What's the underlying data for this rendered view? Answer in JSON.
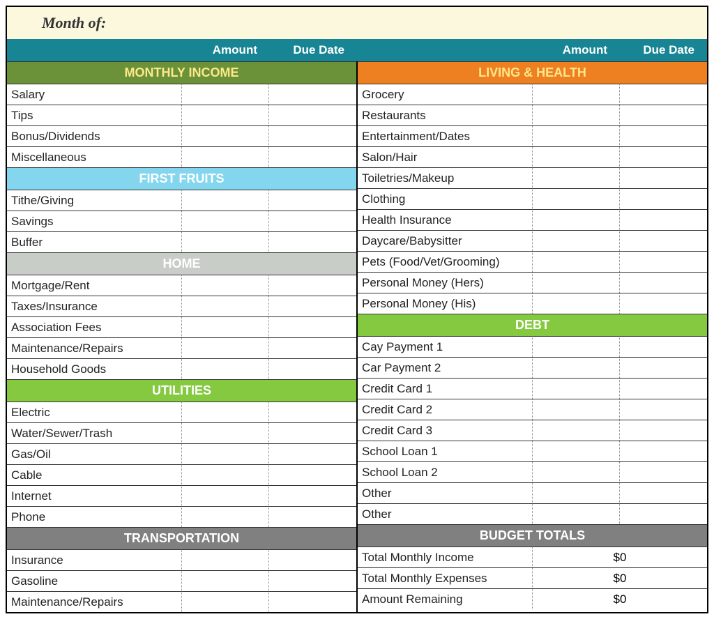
{
  "header": {
    "title": "Month of:"
  },
  "columns": {
    "amount": "Amount",
    "due_date": "Due Date"
  },
  "left": {
    "sections": [
      {
        "title": "MONTHLY INCOME",
        "class": "hdr-income",
        "items": [
          {
            "label": "Salary",
            "amount": "",
            "due": ""
          },
          {
            "label": "Tips",
            "amount": "",
            "due": ""
          },
          {
            "label": "Bonus/Dividends",
            "amount": "",
            "due": ""
          },
          {
            "label": "Miscellaneous",
            "amount": "",
            "due": ""
          }
        ]
      },
      {
        "title": "FIRST FRUITS",
        "class": "hdr-firstfruits",
        "items": [
          {
            "label": "Tithe/Giving",
            "amount": "",
            "due": ""
          },
          {
            "label": "Savings",
            "amount": "",
            "due": ""
          },
          {
            "label": "Buffer",
            "amount": "",
            "due": ""
          }
        ]
      },
      {
        "title": "HOME",
        "class": "hdr-home",
        "items": [
          {
            "label": "Mortgage/Rent",
            "amount": "",
            "due": ""
          },
          {
            "label": "Taxes/Insurance",
            "amount": "",
            "due": ""
          },
          {
            "label": "Association Fees",
            "amount": "",
            "due": ""
          },
          {
            "label": "Maintenance/Repairs",
            "amount": "",
            "due": ""
          },
          {
            "label": "Household Goods",
            "amount": "",
            "due": ""
          }
        ]
      },
      {
        "title": "UTILITIES",
        "class": "hdr-utilities",
        "items": [
          {
            "label": "Electric",
            "amount": "",
            "due": ""
          },
          {
            "label": "Water/Sewer/Trash",
            "amount": "",
            "due": ""
          },
          {
            "label": "Gas/Oil",
            "amount": "",
            "due": ""
          },
          {
            "label": "Cable",
            "amount": "",
            "due": ""
          },
          {
            "label": "Internet",
            "amount": "",
            "due": ""
          },
          {
            "label": "Phone",
            "amount": "",
            "due": ""
          }
        ]
      },
      {
        "title": "TRANSPORTATION",
        "class": "hdr-transportation",
        "items": [
          {
            "label": "Insurance",
            "amount": "",
            "due": ""
          },
          {
            "label": "Gasoline",
            "amount": "",
            "due": ""
          },
          {
            "label": "Maintenance/Repairs",
            "amount": "",
            "due": ""
          }
        ]
      }
    ]
  },
  "right": {
    "sections": [
      {
        "title": "LIVING & HEALTH",
        "class": "hdr-living",
        "items": [
          {
            "label": "Grocery",
            "amount": "",
            "due": ""
          },
          {
            "label": "Restaurants",
            "amount": "",
            "due": ""
          },
          {
            "label": "Entertainment/Dates",
            "amount": "",
            "due": ""
          },
          {
            "label": "Salon/Hair",
            "amount": "",
            "due": ""
          },
          {
            "label": "Toiletries/Makeup",
            "amount": "",
            "due": ""
          },
          {
            "label": "Clothing",
            "amount": "",
            "due": ""
          },
          {
            "label": "Health Insurance",
            "amount": "",
            "due": ""
          },
          {
            "label": "Daycare/Babysitter",
            "amount": "",
            "due": ""
          },
          {
            "label": "Pets (Food/Vet/Grooming)",
            "amount": "",
            "due": ""
          },
          {
            "label": "Personal Money (Hers)",
            "amount": "",
            "due": ""
          },
          {
            "label": "Personal Money (His)",
            "amount": "",
            "due": ""
          }
        ]
      },
      {
        "title": "DEBT",
        "class": "hdr-debt",
        "items": [
          {
            "label": "Cay Payment 1",
            "amount": "",
            "due": ""
          },
          {
            "label": "Car Payment 2",
            "amount": "",
            "due": ""
          },
          {
            "label": "Credit Card 1",
            "amount": "",
            "due": ""
          },
          {
            "label": "Credit Card 2",
            "amount": "",
            "due": ""
          },
          {
            "label": "Credit Card 3",
            "amount": "",
            "due": ""
          },
          {
            "label": "School Loan 1",
            "amount": "",
            "due": ""
          },
          {
            "label": "School Loan 2",
            "amount": "",
            "due": ""
          },
          {
            "label": "Other",
            "amount": "",
            "due": ""
          },
          {
            "label": "Other",
            "amount": "",
            "due": ""
          }
        ]
      }
    ],
    "totals": {
      "title": "BUDGET TOTALS",
      "class": "hdr-totals",
      "items": [
        {
          "label": "Total Monthly Income",
          "amount": "$0"
        },
        {
          "label": "Total Monthly Expenses",
          "amount": "$0"
        },
        {
          "label": "Amount Remaining",
          "amount": "$0"
        }
      ]
    }
  }
}
